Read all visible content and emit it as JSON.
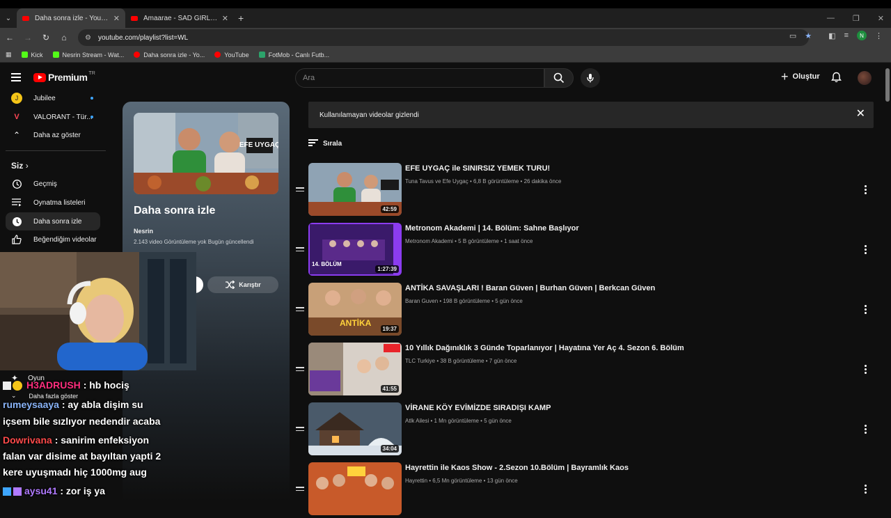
{
  "browser": {
    "tabs": [
      {
        "title": "Daha sonra izle - YouTube",
        "active": true
      },
      {
        "title": "Amaarae - SAD GIRLZ LUV MO",
        "active": false
      }
    ],
    "url": "youtube.com/playlist?list=WL",
    "profile_initial": "N",
    "bookmarks": [
      "Kick",
      "Nesrin Stream - Wat...",
      "Daha sonra izle - Yo...",
      "YouTube",
      "FotMob - Canlı Futb..."
    ]
  },
  "header": {
    "logo_text": "Premium",
    "logo_sup": "TR",
    "search_placeholder": "Ara",
    "create_label": "Oluştur"
  },
  "sidebar": {
    "subs": [
      {
        "label": "Jubilee"
      },
      {
        "label": "VALORANT - Tür..."
      }
    ],
    "show_less": "Daha az göster",
    "section_you": "Siz",
    "you_items": [
      {
        "label": "Geçmiş",
        "icon": "history-icon"
      },
      {
        "label": "Oynatma listeleri",
        "icon": "playlists-icon"
      },
      {
        "label": "Daha sonra izle",
        "icon": "watch-later-icon"
      },
      {
        "label": "Beğendiğim videolar",
        "icon": "like-icon"
      }
    ]
  },
  "playlist": {
    "title": "Daha sonra izle",
    "owner": "Nesrin",
    "meta": "2.143 video   Görüntüleme yok   Bugün güncellendi",
    "shuffle_label": "Karıştır",
    "thumb_tag": "EFE UYGAÇ"
  },
  "main": {
    "banner": "Kullanılamayan videolar gizlendi",
    "sort_label": "Sırala",
    "videos": [
      {
        "title": "EFE UYGAÇ ile SINIRSIZ YEMEK TURU!",
        "meta": "Tuna Tavus ve Efe Uygaç • 6,8 B görüntüleme • 26 dakika önce",
        "duration": "42:59"
      },
      {
        "title": "Metronom Akademi | 14. Bölüm: Sahne Başlıyor",
        "meta": "Metronom Akademi • 5 B görüntüleme • 1 saat önce",
        "duration": "1:27:39"
      },
      {
        "title": "ANTİKA SAVAŞLARI ! Baran Güven | Burhan Güven | Berkcan Güven",
        "meta": "Baran Guven • 198 B görüntüleme • 5 gün önce",
        "duration": "19:37"
      },
      {
        "title": "10 Yıllık Dağınıklık 3 Günde Toparlanıyor | Hayatına Yer Aç 4. Sezon 6. Bölüm",
        "meta": "TLC Turkiye • 38 B görüntüleme • 7 gün önce",
        "duration": "41:55"
      },
      {
        "title": "VİRANE KÖY EVİMİZDE SIRADIŞI KAMP",
        "meta": "Atlk Ailesi • 1 Mn görüntüleme • 5 gün önce",
        "duration": "34:04"
      },
      {
        "title": "Hayrettin ile Kaos Show - 2.Sezon 10.Bölüm | Bayramlık Kaos",
        "meta": "Hayrettin • 6,5 Mn görüntüleme • 13 gün önce",
        "duration": ""
      }
    ]
  },
  "overlay": {
    "game_label": "Oyun",
    "more_label": "Daha fazla göster",
    "chat": [
      {
        "user": "H3ADRUSH",
        "color": "#ff2e7e",
        "text": ": hb hociş"
      },
      {
        "user": "rumeysaaya",
        "color": "#8ab4f8",
        "text": ": ay abla dişim su"
      },
      {
        "user": "",
        "color": "#ffffff",
        "text": "içsem bile sızlıyor nedendir acaba"
      },
      {
        "user": "Dowrivana",
        "color": "#ff4a4a",
        "text": ": sanirim enfeksiyon"
      },
      {
        "user": "",
        "color": "#ffffff",
        "text": "falan var disime at bayıltan yapti 2"
      },
      {
        "user": "",
        "color": "#ffffff",
        "text": "kere uyuşmadı hiç 1000mg aug"
      },
      {
        "user": "aysu41",
        "color": "#b07aff",
        "text": ": zor iş ya"
      }
    ]
  }
}
